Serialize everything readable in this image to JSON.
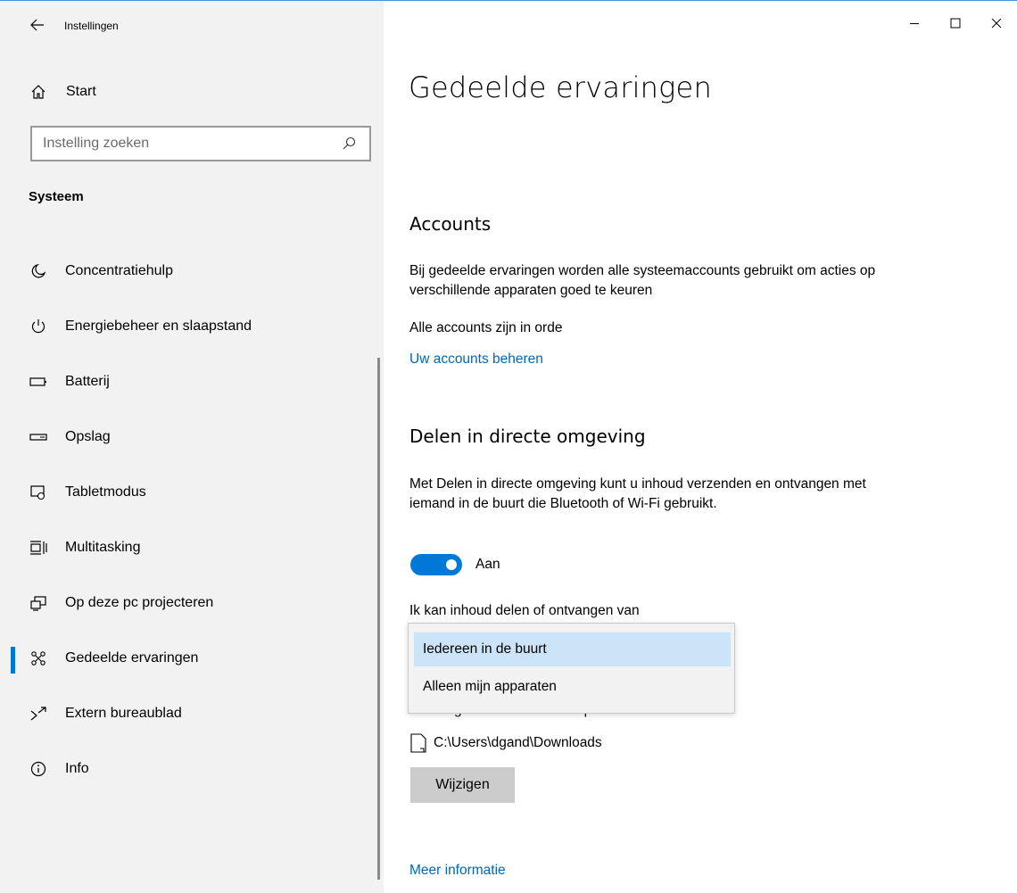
{
  "app": {
    "title": "Instellingen"
  },
  "sidebar": {
    "home_label": "Start",
    "search_placeholder": "Instelling zoeken",
    "section": "Systeem",
    "items": [
      {
        "label": "Concentratiehulp",
        "icon": "moon-icon"
      },
      {
        "label": "Energiebeheer en slaapstand",
        "icon": "power-icon"
      },
      {
        "label": "Batterij",
        "icon": "battery-icon"
      },
      {
        "label": "Opslag",
        "icon": "storage-icon"
      },
      {
        "label": "Tabletmodus",
        "icon": "tablet-mode-icon"
      },
      {
        "label": "Multitasking",
        "icon": "multitasking-icon"
      },
      {
        "label": "Op deze pc projecteren",
        "icon": "project-icon"
      },
      {
        "label": "Gedeelde ervaringen",
        "icon": "shared-experiences-icon",
        "selected": true
      },
      {
        "label": "Extern bureaublad",
        "icon": "remote-desktop-icon"
      },
      {
        "label": "Info",
        "icon": "info-icon"
      }
    ]
  },
  "main": {
    "title": "Gedeelde ervaringen",
    "accounts": {
      "heading": "Accounts",
      "description": "Bij gedeelde ervaringen worden alle systeemaccounts gebruikt om acties op verschillende apparaten goed te keuren",
      "status": "Alle accounts zijn in orde",
      "manage_link": "Uw accounts beheren"
    },
    "nearby": {
      "heading": "Delen in directe omgeving",
      "description": "Met Delen in directe omgeving kunt u inhoud verzenden en ontvangen met iemand in de buurt die Bluetooth of Wi-Fi gebruikt.",
      "toggle_state": "Aan",
      "toggle_on": true,
      "share_label": "Ik kan inhoud delen of ontvangen van",
      "dropdown_options": [
        "Iedereen in de buurt",
        "Alleen mijn apparaten"
      ],
      "save_label": "Ontvangen bestanden hier opslaan",
      "save_path": "C:\\Users\\dgand\\Downloads",
      "change_button": "Wijzigen",
      "more_info_link": "Meer informatie"
    }
  },
  "colors": {
    "accent": "#0078d7",
    "link": "#0067b8",
    "selected_option": "#cce4f7"
  }
}
